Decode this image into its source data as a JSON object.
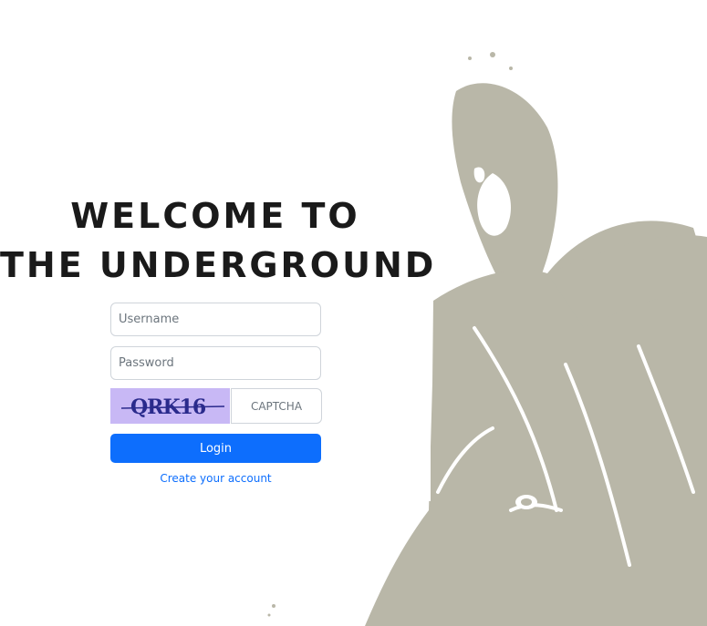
{
  "hero": {
    "line1": "WELCOME TO",
    "line2": "THE UNDERGROUND"
  },
  "form": {
    "username_placeholder": "Username",
    "password_placeholder": "Password",
    "captcha_code": "QRK16",
    "captcha_placeholder": "CAPTCHA",
    "login_label": "Login",
    "create_account_label": "Create your account"
  },
  "colors": {
    "primary": "#0d6efd",
    "figure": "#b9b7a8",
    "captcha_bg": "#c8b8f5",
    "captcha_text": "#2a2a8c"
  }
}
